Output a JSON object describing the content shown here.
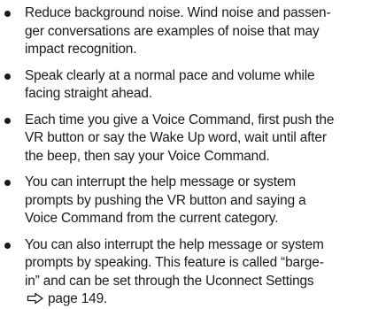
{
  "items": [
    {
      "lines": [
        "Reduce background noise. Wind noise and passen-",
        "ger conversations are examples of noise that may",
        "impact recognition."
      ]
    },
    {
      "lines": [
        "Speak clearly at a normal pace and volume while",
        "facing straight ahead."
      ]
    },
    {
      "lines": [
        "Each time you give a Voice Command, first push the",
        "VR button or say the Wake Up word, wait until after",
        "the beep, then say your Voice Command."
      ]
    },
    {
      "lines": [
        "You can interrupt the help message or system",
        "prompts by pushing the VR button and saying a",
        "Voice Command from the current category."
      ]
    },
    {
      "lines": [
        "You can also interrupt the help message or system",
        "prompts by speaking. This feature is called “barge-",
        "in” and can be set through the Uconnect Settings"
      ],
      "reference_text": "page 149."
    }
  ],
  "icons": {
    "page_reference": "arrow-right-outline-icon"
  }
}
